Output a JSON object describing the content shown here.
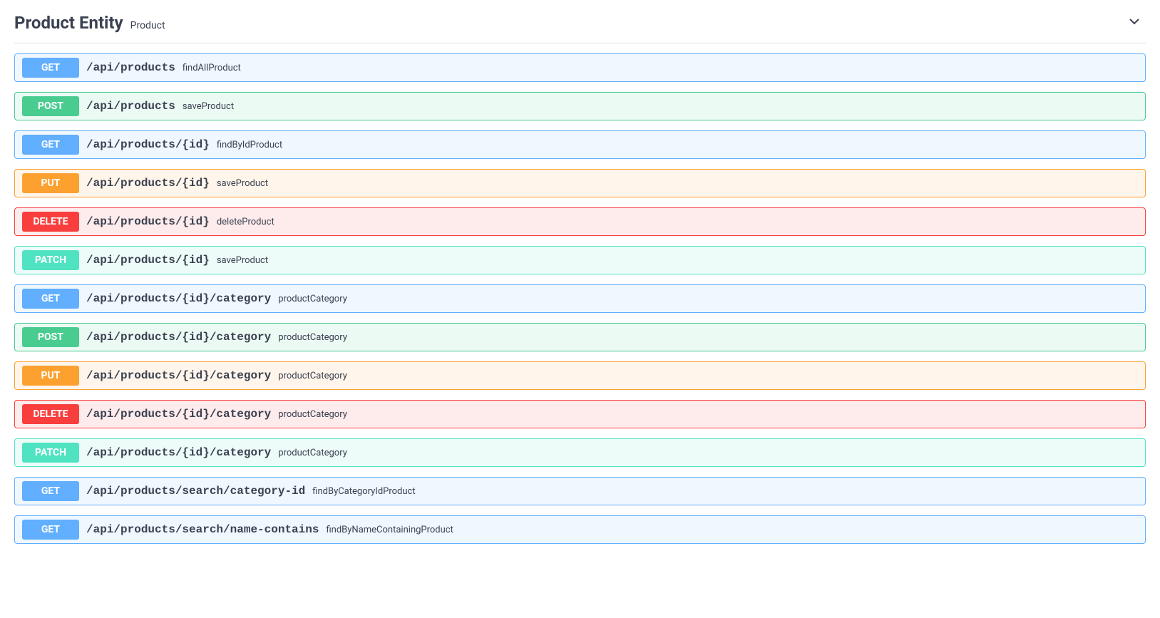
{
  "section": {
    "title": "Product Entity",
    "subtitle": "Product"
  },
  "methods": {
    "get": "GET",
    "post": "POST",
    "put": "PUT",
    "delete": "DELETE",
    "patch": "PATCH"
  },
  "operations": [
    {
      "method": "get",
      "path": "/api/products",
      "summary": "findAllProduct"
    },
    {
      "method": "post",
      "path": "/api/products",
      "summary": "saveProduct"
    },
    {
      "method": "get",
      "path": "/api/products/{id}",
      "summary": "findByIdProduct"
    },
    {
      "method": "put",
      "path": "/api/products/{id}",
      "summary": "saveProduct"
    },
    {
      "method": "delete",
      "path": "/api/products/{id}",
      "summary": "deleteProduct"
    },
    {
      "method": "patch",
      "path": "/api/products/{id}",
      "summary": "saveProduct"
    },
    {
      "method": "get",
      "path": "/api/products/{id}/category",
      "summary": "productCategory"
    },
    {
      "method": "post",
      "path": "/api/products/{id}/category",
      "summary": "productCategory"
    },
    {
      "method": "put",
      "path": "/api/products/{id}/category",
      "summary": "productCategory"
    },
    {
      "method": "delete",
      "path": "/api/products/{id}/category",
      "summary": "productCategory"
    },
    {
      "method": "patch",
      "path": "/api/products/{id}/category",
      "summary": "productCategory"
    },
    {
      "method": "get",
      "path": "/api/products/search/category-id",
      "summary": "findByCategoryIdProduct"
    },
    {
      "method": "get",
      "path": "/api/products/search/name-contains",
      "summary": "findByNameContainingProduct"
    }
  ]
}
